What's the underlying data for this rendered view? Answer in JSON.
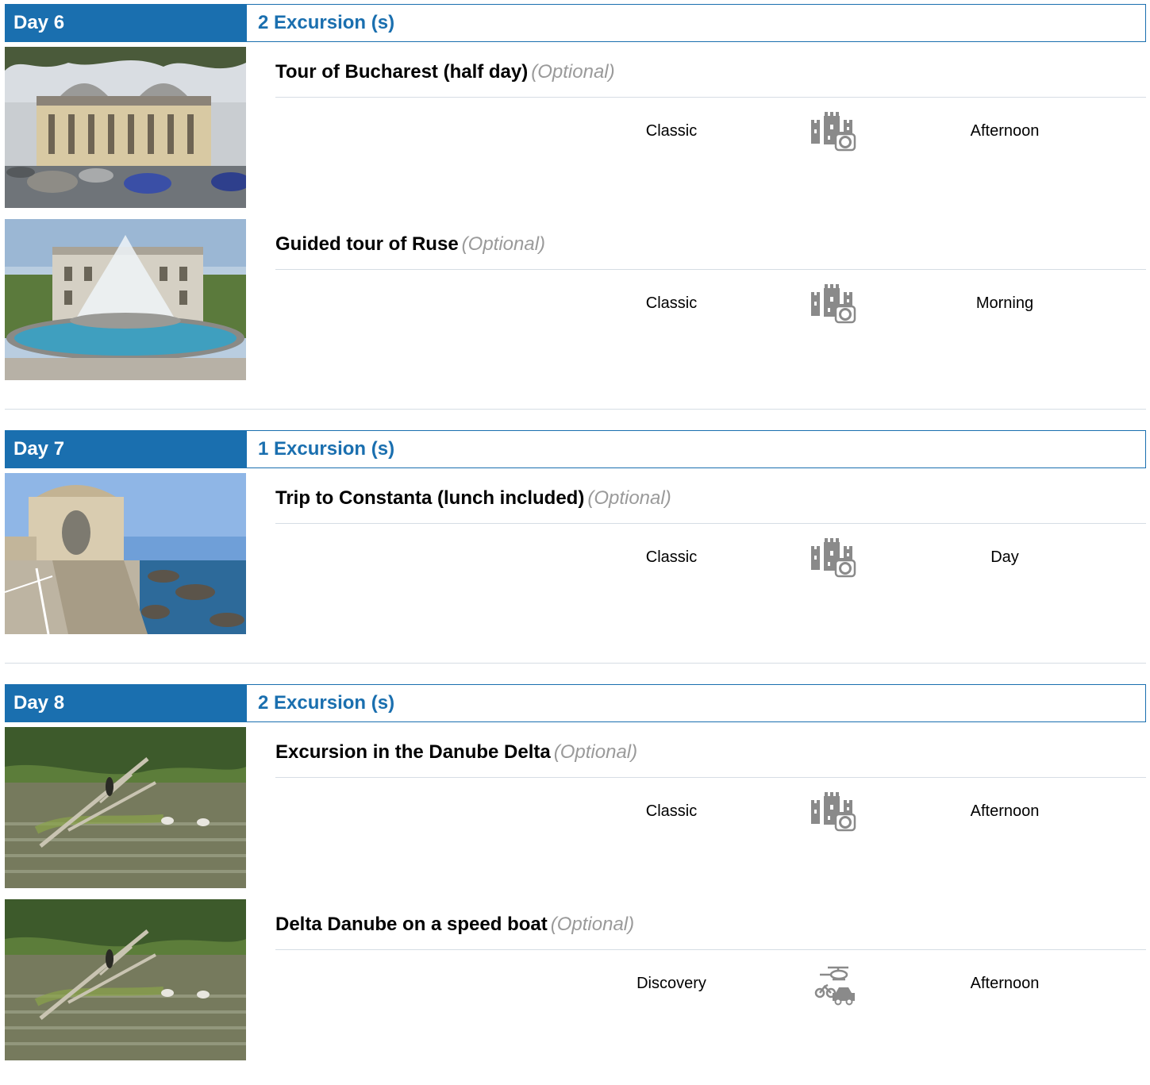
{
  "days": [
    {
      "label": "Day 6",
      "excursion_count": "2 Excursion (s)",
      "excursions": [
        {
          "title": "Tour of Bucharest (half day)",
          "optional": "(Optional)",
          "category": "Classic",
          "icon": "castle-camera-icon",
          "time": "Afternoon",
          "image": "bucharest-palace-photo"
        },
        {
          "title": "Guided tour of Ruse",
          "optional": "(Optional)",
          "category": "Classic",
          "icon": "castle-camera-icon",
          "time": "Morning",
          "image": "ruse-fountain-photo"
        }
      ]
    },
    {
      "label": "Day 7",
      "excursion_count": "1 Excursion (s)",
      "excursions": [
        {
          "title": "Trip to Constanta (lunch included)",
          "optional": "(Optional)",
          "category": "Classic",
          "icon": "castle-camera-icon",
          "time": "Day",
          "image": "constanta-casino-photo"
        }
      ]
    },
    {
      "label": "Day 8",
      "excursion_count": "2 Excursion (s)",
      "excursions": [
        {
          "title": "Excursion in the Danube Delta",
          "optional": "(Optional)",
          "category": "Classic",
          "icon": "castle-camera-icon",
          "time": "Afternoon",
          "image": "danube-delta-birds-photo"
        },
        {
          "title": "Delta Danube on a speed boat",
          "optional": "(Optional)",
          "category": "Discovery",
          "icon": "helicopter-bike-car-icon",
          "time": "Afternoon",
          "image": "danube-delta-birds-photo"
        }
      ]
    }
  ],
  "colors": {
    "accent": "#1a6faf",
    "optional_text": "#9a9a9a",
    "rule": "#d6dde4"
  }
}
